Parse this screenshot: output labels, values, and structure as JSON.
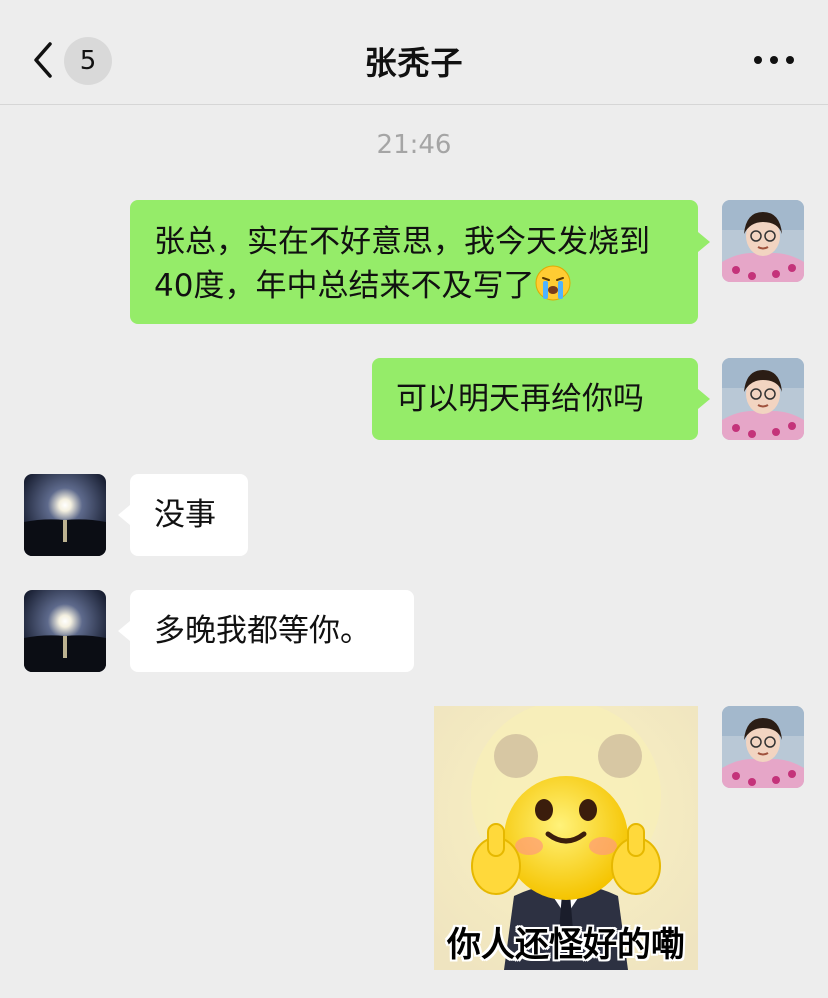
{
  "header": {
    "title": "张秃子",
    "unread_count": "5"
  },
  "chat": {
    "timestamp": "21:46",
    "messages": [
      {
        "side": "right",
        "type": "text",
        "text": "张总，实在不好意思，我今天发烧到40度，年中总结来不及写了"
      },
      {
        "side": "right",
        "type": "text",
        "text": "可以明天再给你吗"
      },
      {
        "side": "left",
        "type": "text",
        "text": "没事"
      },
      {
        "side": "left",
        "type": "text",
        "text": "多晚我都等你。"
      },
      {
        "side": "right",
        "type": "sticker",
        "caption": "你人还怪好的嘞"
      }
    ]
  },
  "colors": {
    "background": "#ededed",
    "sent_bubble": "#95ec69",
    "received_bubble": "#ffffff",
    "timestamp": "#a5a5a5"
  },
  "icons": {
    "back": "chevron-left-icon",
    "more": "more-dots-icon",
    "inline_emoji": "crying-face-emoji"
  }
}
